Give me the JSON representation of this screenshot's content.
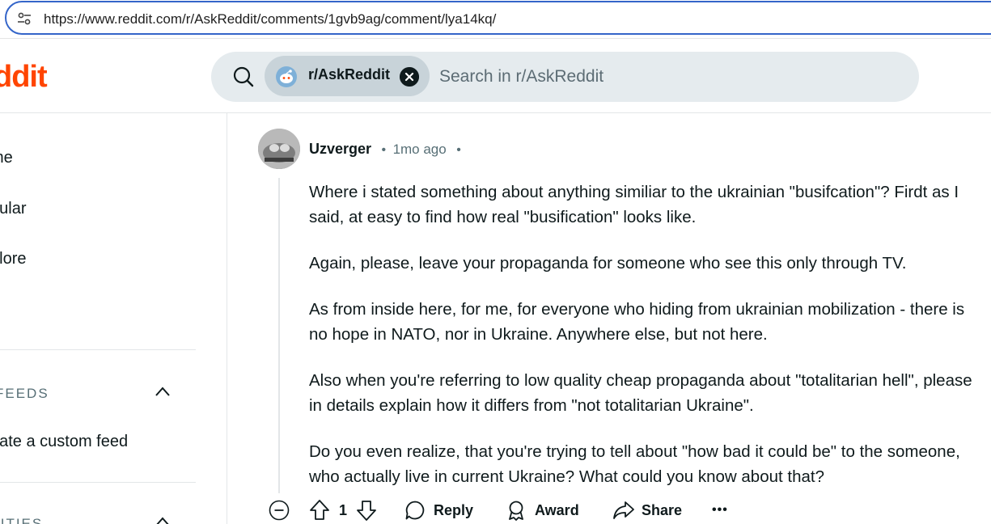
{
  "browser": {
    "url": "https://www.reddit.com/r/AskReddit/comments/1gvb9ag/comment/lya14kq/"
  },
  "header": {
    "logo_text": "ddit",
    "search": {
      "community_chip": "r/AskReddit",
      "placeholder": "Search in r/AskReddit"
    }
  },
  "sidebar": {
    "items": [
      {
        "label": "me"
      },
      {
        "label": "pular"
      },
      {
        "label": "plore"
      }
    ],
    "feeds_section": {
      "label": "FEEDS",
      "create_label": "eate a custom feed"
    },
    "communities_section": {
      "label": "IITIES"
    }
  },
  "comment": {
    "author": "Uzverger",
    "time": "1mo ago",
    "paragraphs": [
      "Where i stated something about anything similiar to the ukrainian \"busifcation\"? Firdt as I said, at easy to find how real \"busification\" looks like.",
      "Again, please, leave your propaganda for someone who see this only through TV.",
      "As from inside here, for me, for everyone who hiding from ukrainian mobilization - there is no hope in NATO, nor in Ukraine. Anywhere else, but not here.",
      "Also when you're referring to low quality cheap propaganda about \"totalitarian hell\", please in details explain how it differs from \"not totalitarian Ukraine\".",
      "Do you even realize, that you're trying to tell about \"how bad it could be\" to the someone, who actually live in current Ukraine? What could you know about that?"
    ],
    "actions": {
      "vote_count": "1",
      "reply": "Reply",
      "award": "Award",
      "share": "Share",
      "more": "•••"
    }
  },
  "colors": {
    "brand": "#ff4500",
    "search_bg": "#e5ebee",
    "chip_bg": "#c8d3d9",
    "address_focus": "#3465c9"
  }
}
